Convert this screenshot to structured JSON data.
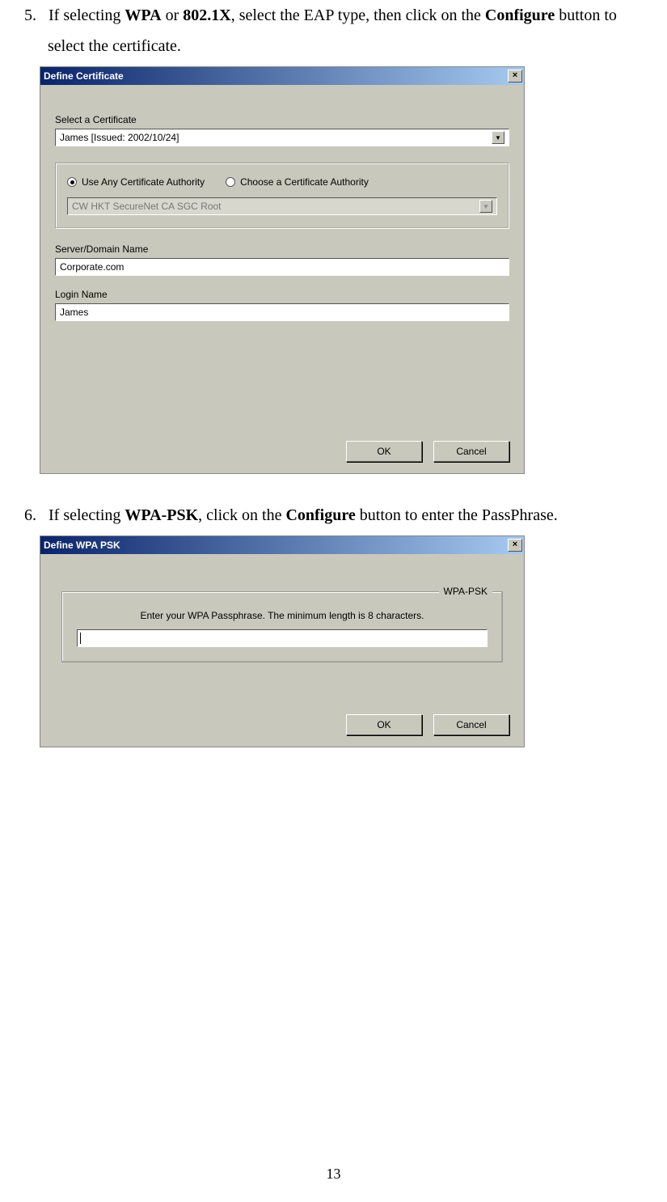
{
  "step5": {
    "num": "5.",
    "text_pre": "If selecting ",
    "wpa": "WPA",
    "or": " or ",
    "dot1x": "802.1X",
    "text_mid": ", select the EAP type, then click on the ",
    "configure": "Configure",
    "text_post": " button to select the certificate."
  },
  "dlg1": {
    "title": "Define Certificate",
    "close": "×",
    "select_label": "Select a Certificate",
    "select_value": "James   [Issued: 2002/10/24]",
    "radio1": "Use Any Certificate Authority",
    "radio2": "Choose a Certificate Authority",
    "ca_value": "CW HKT SecureNet CA SGC Root",
    "server_label": "Server/Domain Name",
    "server_value": "Corporate.com",
    "login_label": "Login Name",
    "login_value": "James",
    "ok": "OK",
    "cancel": "Cancel"
  },
  "step6": {
    "num": "6.",
    "text_pre": "If selecting ",
    "wpapsk": "WPA-PSK",
    "text_mid": ", click on the ",
    "configure": "Configure",
    "text_post": " button to enter the PassPhrase."
  },
  "dlg2": {
    "title": "Define WPA PSK",
    "close": "×",
    "legend": "WPA-PSK",
    "instruction": "Enter your WPA Passphrase.  The minimum length is 8 characters.",
    "ok": "OK",
    "cancel": "Cancel"
  },
  "page_num": "13"
}
